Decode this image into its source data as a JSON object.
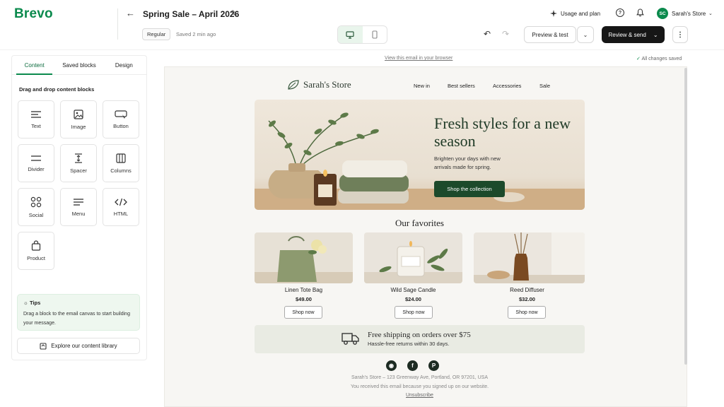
{
  "app": {
    "brand": "Brevo"
  },
  "header": {
    "title": "Spring Sale – April 2026",
    "badge": "Regular",
    "saved_status": "Saved 2 min ago",
    "usage_label": "Usage and plan",
    "account_initials": "SC",
    "account_name": "Sarah's Store"
  },
  "toolbar": {
    "preview_label": "Preview & test",
    "send_label": "Review & send"
  },
  "panel": {
    "tabs": [
      "Content",
      "Saved blocks",
      "Design"
    ],
    "active_tab": "Content",
    "heading": "Drag and drop content blocks",
    "blocks": [
      {
        "label": "Text",
        "icon": "text-icon"
      },
      {
        "label": "Image",
        "icon": "image-icon"
      },
      {
        "label": "Button",
        "icon": "button-icon"
      },
      {
        "label": "Divider",
        "icon": "divider-icon"
      },
      {
        "label": "Spacer",
        "icon": "spacer-icon"
      },
      {
        "label": "Columns",
        "icon": "columns-icon"
      },
      {
        "label": "Social",
        "icon": "social-icon"
      },
      {
        "label": "Menu",
        "icon": "menu-icon"
      },
      {
        "label": "HTML",
        "icon": "code-icon"
      },
      {
        "label": "Product",
        "icon": "bag-icon"
      }
    ],
    "tips_title": "Tips",
    "tips_text": "Drag a block to the email canvas to start building your message.",
    "explore_label": "Explore our content library"
  },
  "canvas": {
    "view_in_browser": "View this email in your browser",
    "all_saved": "All changes saved"
  },
  "email": {
    "logo": "Sarah's Store",
    "nav": [
      "New in",
      "Best sellers",
      "Accessories",
      "Sale"
    ],
    "hero_title": "Fresh styles for a new season",
    "hero_subtitle": "Brighten your days with new arrivals made for spring.",
    "hero_button": "Shop the collection",
    "favorites_title": "Our favorites",
    "products": [
      {
        "name": "Linen Tote Bag",
        "price": "$49.00",
        "button": "Shop now"
      },
      {
        "name": "Wild Sage Candle",
        "price": "$24.00",
        "button": "Shop now"
      },
      {
        "name": "Reed Diffuser",
        "price": "$32.00",
        "button": "Shop now"
      }
    ],
    "shipping_title": "Free shipping on orders over $75",
    "shipping_subtitle": "Hassle-free returns within 30 days.",
    "footer_address": "Sarah's Store – 123 Greenway Ave, Portland, OR 97201, USA",
    "footer_note": "You received this email because you signed up on our website.",
    "unsubscribe": "Unsubscribe"
  },
  "colors": {
    "brand": "#0b8a4d",
    "accent_dark": "#1c4a2b",
    "send_button": "#161616"
  }
}
